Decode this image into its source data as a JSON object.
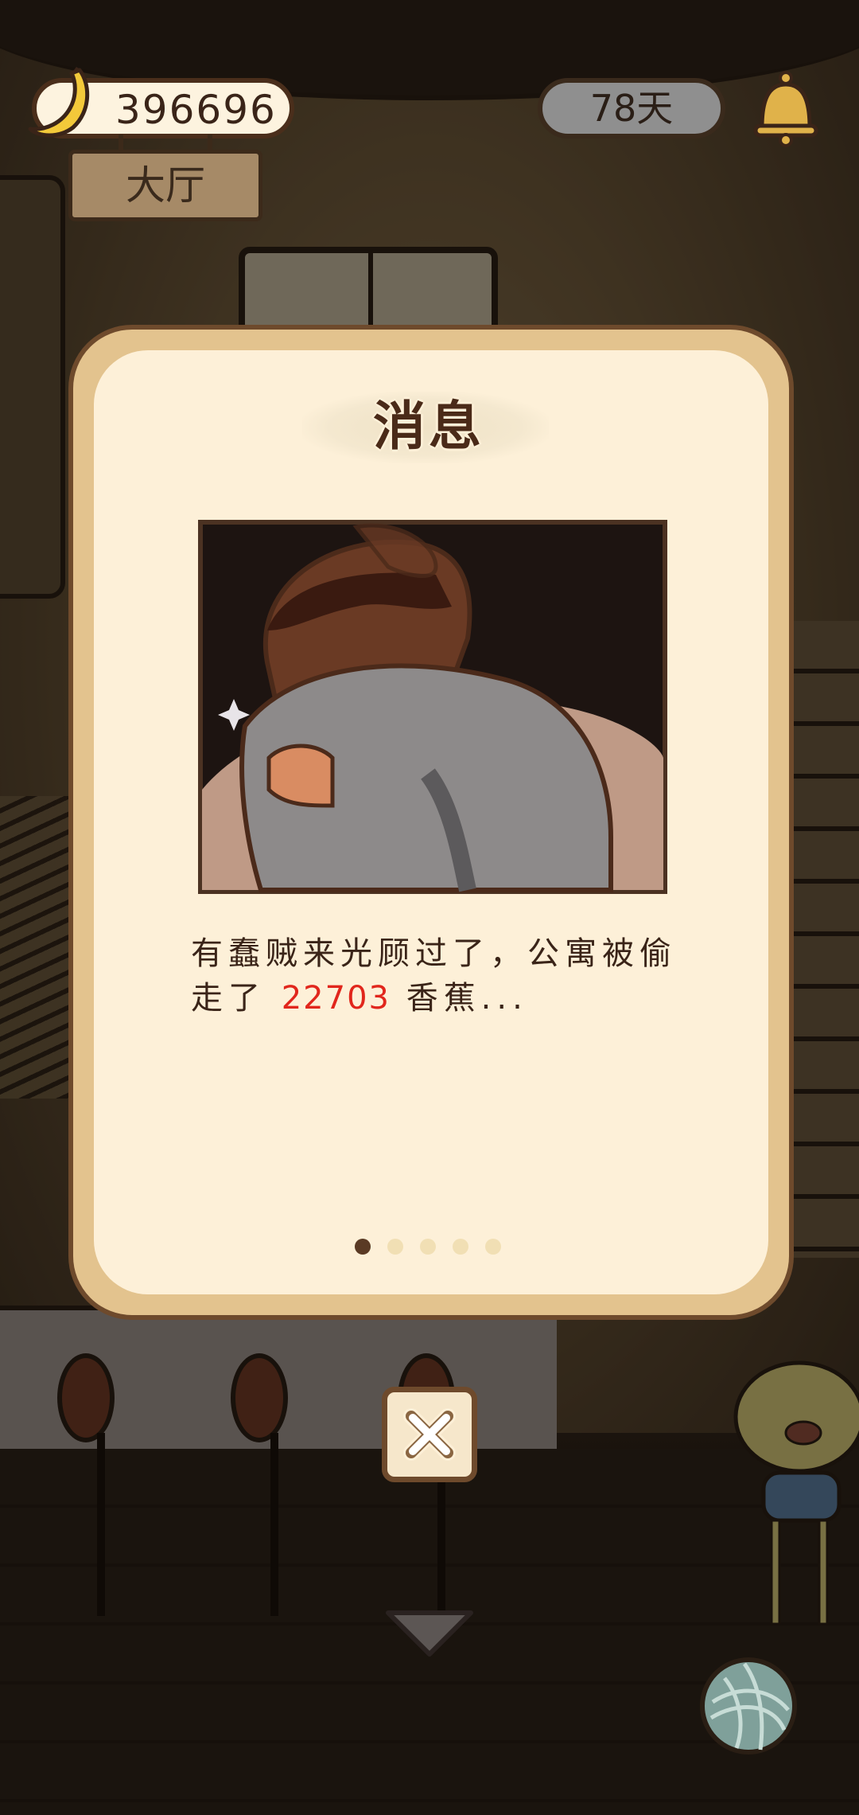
{
  "hud": {
    "banana_count": "396696",
    "room_name": "大厅",
    "days": "78天",
    "bell_icon": "bell-icon",
    "banana_icon": "banana-icon"
  },
  "dialog": {
    "title": "消息",
    "message_before": "有蠢贼来光顾过了，公寓被偷走了",
    "stolen_amount": "22703",
    "message_after": "香蕉...",
    "page_count": 5,
    "active_page": 1,
    "close_icon": "close-icon"
  },
  "colors": {
    "dialog_frame": "#e3c38e",
    "dialog_body": "#fdf0d8",
    "highlight_number": "#e1261c",
    "text_brown": "#3a2418"
  }
}
